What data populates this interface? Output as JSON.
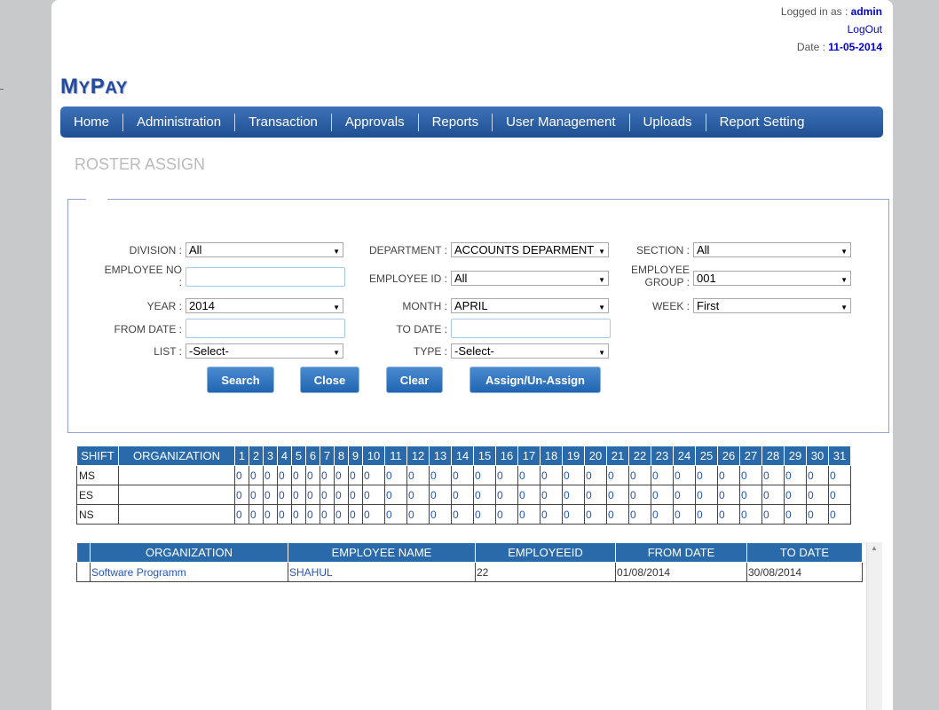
{
  "header": {
    "logged_in_label": "Logged in as :",
    "username": "admin",
    "logout": "LogOut",
    "date_label": "Date :",
    "date": "11-05-2014"
  },
  "logo": {
    "text_big": "M",
    "text_small": "Y",
    "text_big2": "P",
    "text_small2": "AY"
  },
  "nav": [
    "Home",
    "Administration",
    "Transaction",
    "Approvals",
    "Reports",
    "User Management",
    "Uploads",
    "Report Setting"
  ],
  "page_title": "ROSTER ASSIGN",
  "form": {
    "division_label": "DIVISION :",
    "division_value": "All",
    "department_label": "DEPARTMENT :",
    "department_value": "ACCOUNTS DEPARMENT",
    "section_label": "SECTION :",
    "section_value": "All",
    "employee_no_label_1": "EMPLOYEE NO",
    "employee_no_label_2": ":",
    "employee_id_label": "EMPLOYEE ID :",
    "employee_id_value": "All",
    "employee_group_label_1": "EMPLOYEE",
    "employee_group_label_2": "GROUP :",
    "employee_group_value": "001",
    "year_label": "YEAR :",
    "year_value": "2014",
    "month_label": "MONTH :",
    "month_value": "APRIL",
    "week_label": "WEEK :",
    "week_value": "First",
    "from_date_label": "FROM DATE :",
    "to_date_label": "TO DATE :",
    "list_label": "LIST :",
    "list_value": "-Select-",
    "type_label": "TYPE :",
    "type_value": "-Select-"
  },
  "buttons": {
    "search": "Search",
    "close": "Close",
    "clear": "Clear",
    "assign": "Assign/Un-Assign"
  },
  "shift_table": {
    "headers": [
      "SHIFT",
      "ORGANIZATION",
      "1",
      "2",
      "3",
      "4",
      "5",
      "6",
      "7",
      "8",
      "9",
      "10",
      "11",
      "12",
      "13",
      "14",
      "15",
      "16",
      "17",
      "18",
      "19",
      "20",
      "21",
      "22",
      "23",
      "24",
      "25",
      "26",
      "27",
      "28",
      "29",
      "30",
      "31"
    ],
    "rows": [
      {
        "shift": "MS",
        "organization": "",
        "values": [
          "0",
          "0",
          "0",
          "0",
          "0",
          "0",
          "0",
          "0",
          "0",
          "0",
          "0",
          "0",
          "0",
          "0",
          "0",
          "0",
          "0",
          "0",
          "0",
          "0",
          "0",
          "0",
          "0",
          "0",
          "0",
          "0",
          "0",
          "0",
          "0",
          "0",
          "0"
        ]
      },
      {
        "shift": "ES",
        "organization": "",
        "values": [
          "0",
          "0",
          "0",
          "0",
          "0",
          "0",
          "0",
          "0",
          "0",
          "0",
          "0",
          "0",
          "0",
          "0",
          "0",
          "0",
          "0",
          "0",
          "0",
          "0",
          "0",
          "0",
          "0",
          "0",
          "0",
          "0",
          "0",
          "0",
          "0",
          "0",
          "0"
        ]
      },
      {
        "shift": "NS",
        "organization": "",
        "values": [
          "0",
          "0",
          "0",
          "0",
          "0",
          "0",
          "0",
          "0",
          "0",
          "0",
          "0",
          "0",
          "0",
          "0",
          "0",
          "0",
          "0",
          "0",
          "0",
          "0",
          "0",
          "0",
          "0",
          "0",
          "0",
          "0",
          "0",
          "0",
          "0",
          "0",
          "0"
        ]
      }
    ]
  },
  "employee_table": {
    "headers": [
      "",
      "ORGANIZATION",
      "EMPLOYEE NAME",
      "EMPLOYEEID",
      "FROM DATE",
      "TO DATE"
    ],
    "rows": [
      {
        "organization": "Software Programm",
        "employee_name": "SHAHUL",
        "employee_id": "22",
        "from_date": "01/08/2014",
        "to_date": "30/08/2014"
      }
    ]
  }
}
